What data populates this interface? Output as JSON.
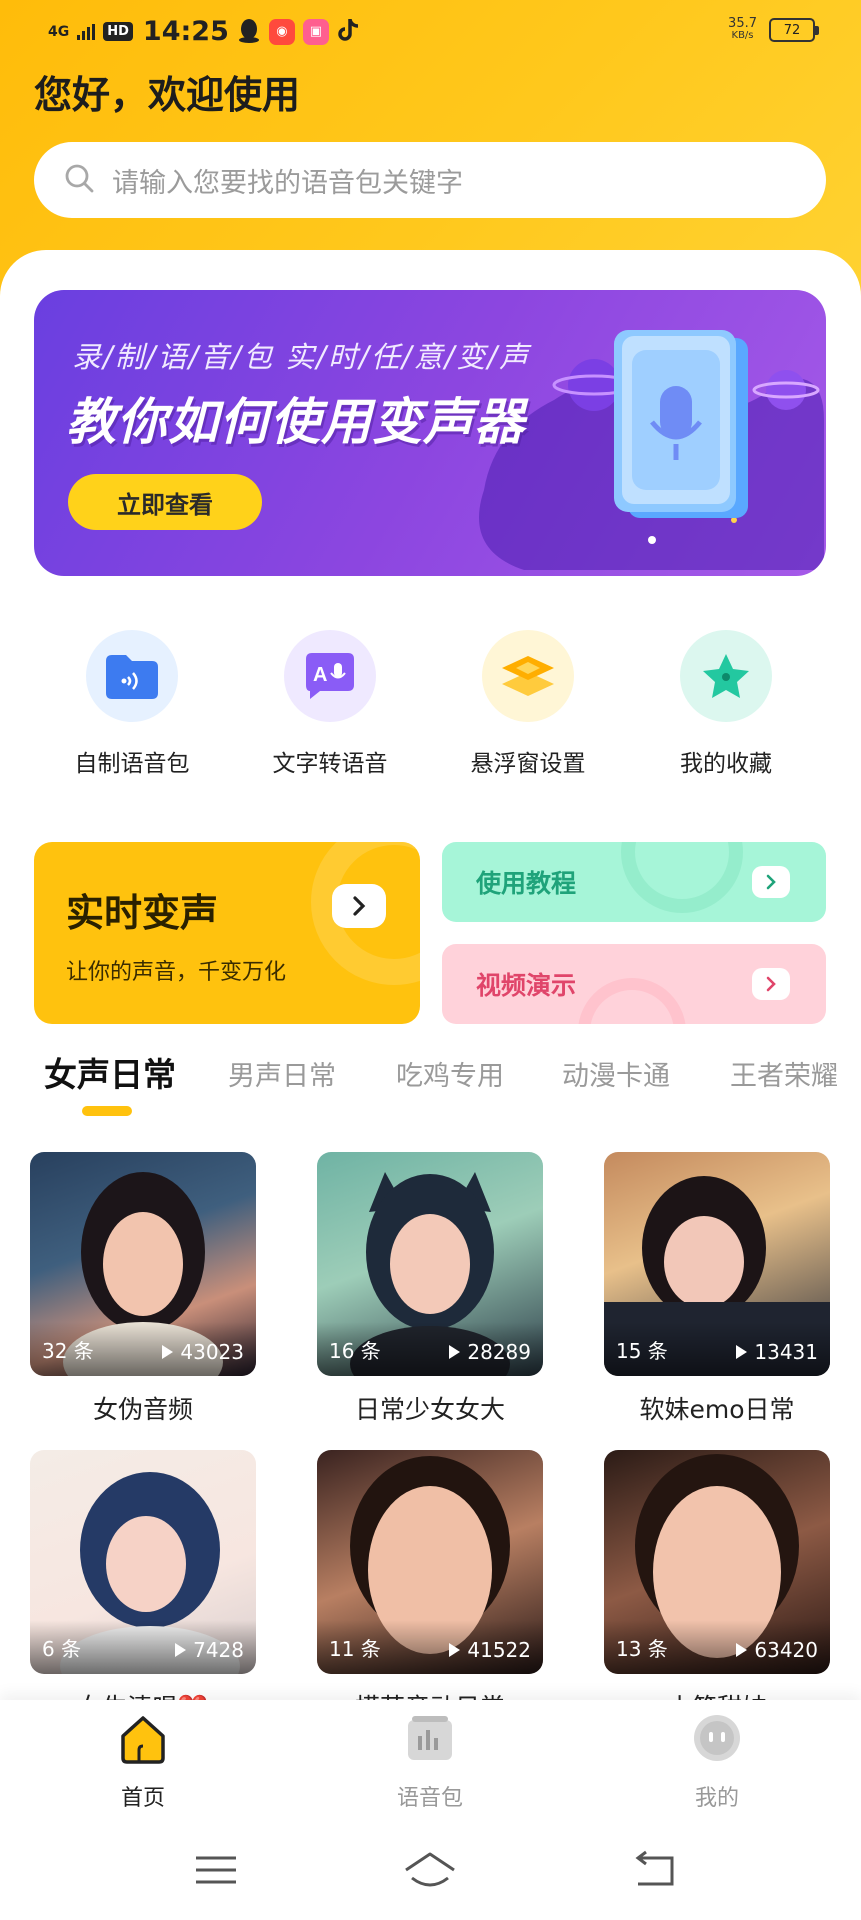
{
  "status_bar": {
    "network": "4G",
    "hd": "HD",
    "time": "14:25",
    "app_icons": [
      "qq-icon",
      "kuaishou-icon",
      "bilibili-icon",
      "tiktok-icon"
    ],
    "speed_value": "35.7",
    "speed_unit": "KB/s",
    "battery": "72"
  },
  "header": {
    "greeting": "您好，欢迎使用"
  },
  "search": {
    "placeholder": "请输入您要找的语音包关键字"
  },
  "banner": {
    "subtitle": "录/制/语/音/包   实/时/任/意/变/声",
    "title": "教你如何使用变声器",
    "button": "立即查看"
  },
  "features": [
    {
      "label": "自制语音包",
      "icon": "folder-audio-icon",
      "color": "#3d7bf0",
      "bg": "#e6f1ff"
    },
    {
      "label": "文字转语音",
      "icon": "text-to-speech-icon",
      "color": "#8a5cf6",
      "bg": "#efe9ff"
    },
    {
      "label": "悬浮窗设置",
      "icon": "layers-icon",
      "color": "#ffb400",
      "bg": "#fff6d6"
    },
    {
      "label": "我的收藏",
      "icon": "star-icon",
      "color": "#23c8a0",
      "bg": "#dcf7ef"
    }
  ],
  "cards": {
    "realtime": {
      "title": "实时变声",
      "subtitle": "让你的声音，千变万化"
    },
    "tutorial": {
      "title": "使用教程",
      "color": "#1fa37a",
      "bg": "#a6f5d8"
    },
    "video": {
      "title": "视频演示",
      "color": "#e0456a",
      "bg": "#ffd2da"
    }
  },
  "tabs": [
    {
      "label": "女声日常",
      "active": true
    },
    {
      "label": "男声日常",
      "active": false
    },
    {
      "label": "吃鸡专用",
      "active": false
    },
    {
      "label": "动漫卡通",
      "active": false
    },
    {
      "label": "王者荣耀",
      "active": false
    }
  ],
  "voice_packs": [
    {
      "name": "女伪音频",
      "count": "32 条",
      "plays": "43023"
    },
    {
      "name": "日常少女女大",
      "count": "16 条",
      "plays": "28289"
    },
    {
      "name": "软妹emo日常",
      "count": "15 条",
      "plays": "13431"
    },
    {
      "name": "女生清唱❤️",
      "count": "6 条",
      "plays": "7428"
    },
    {
      "name": "模范音动日常",
      "count": "11 条",
      "plays": "41522"
    },
    {
      "name": "小笼甜妹",
      "count": "13 条",
      "plays": "63420"
    }
  ],
  "bottom_nav": [
    {
      "label": "首页",
      "icon": "home-icon",
      "active": true
    },
    {
      "label": "语音包",
      "icon": "voice-pack-icon",
      "active": false
    },
    {
      "label": "我的",
      "icon": "profile-icon",
      "active": false
    }
  ],
  "colors": {
    "accent": "#ffc20e",
    "banner": "#7a44e2"
  }
}
